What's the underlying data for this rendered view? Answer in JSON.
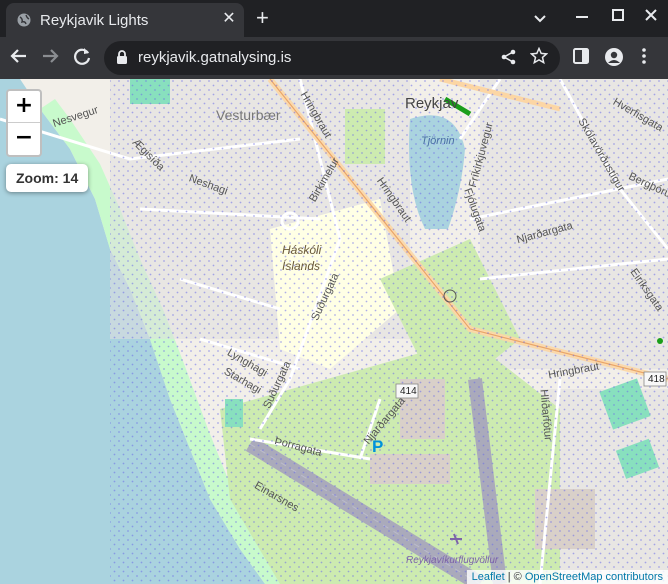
{
  "browser": {
    "tab_title": "Reykjavik Lights",
    "tab_close": "✕",
    "new_tab": "+",
    "url": "reykjavik.gatnalysing.is"
  },
  "map": {
    "zoom_in": "+",
    "zoom_out": "−",
    "zoom_label": "Zoom: 14",
    "attribution_link": "Leaflet",
    "attribution_sep": " | © ",
    "attribution_text": "OpenStreetMap contributors",
    "labels": {
      "vesturbaer": "Vesturbær",
      "reykjavik": "Reykjav",
      "tjornin": "Tjörnin",
      "haskoli1": "Háskóli",
      "haskoli2": "Íslands",
      "nesvegur": "Nesvegur",
      "aegisida": "Ægisíða",
      "neshagi": "Neshagi",
      "hringbraut1": "Hringbraut",
      "hringbraut2": "Hringbraut",
      "hringbraut3": "Hringbraut",
      "birkimelur": "Birkimelur",
      "sudurgata": "Suðurgata",
      "sudurgata2": "Suðurgata",
      "lynghagi": "Lynghagi",
      "starhagi": "Starhagi",
      "thorragata": "Þorragata",
      "njardargata": "Njarðargata",
      "njardargata2": "Njarðargata",
      "einarsnes": "Einarsnes",
      "fjolugata": "Fjólugata",
      "sokkvabraut": "Skólavörðustígur",
      "frikirkjuvegur": "Fríkirkjuvegur",
      "bergthorugata": "Bergþórugata",
      "eiriksgata": "Eiríksgata",
      "hverfisgata": "Hverfisgata",
      "hlidarfotur": "Hlíðarfótur",
      "airport": "Reykjavíkurflugvöllur",
      "road414": "414",
      "road418": "418",
      "parking": "P"
    }
  }
}
